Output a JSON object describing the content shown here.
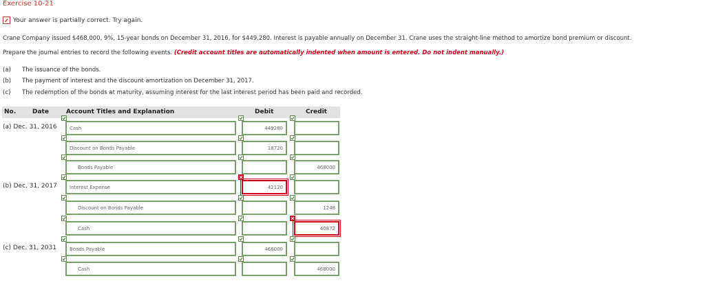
{
  "exercise_title": "Exercise 10-21",
  "banner": {
    "text": "Your answer is partially correct.  Try again."
  },
  "problem_text": "Crane Company issued $468,000, 9%, 15-year bonds on December 31, 2016, for $449,280. Interest is payable annually on December 31. Crane uses the straight-line method to amortize bond premium or discount.",
  "instructions": {
    "prefix": "Prepare the journal entries to record the following events. ",
    "emphasis": "(Credit account titles are automatically indented when amount is entered. Do not indent manually.)"
  },
  "requirements": [
    {
      "letter": "(a)",
      "text": "The issuance of the bonds."
    },
    {
      "letter": "(b)",
      "text": "The payment of interest and the discount amortization on December 31, 2017."
    },
    {
      "letter": "(c)",
      "text": "The redemption of the bonds at maturity, assuming interest for the last interest period has been paid and recorded."
    }
  ],
  "table_headers": {
    "no": "No.",
    "date": "Date",
    "account": "Account Titles and Explanation",
    "debit": "Debit",
    "credit": "Credit"
  },
  "entries": [
    {
      "label": "(a)  Dec. 31, 2016",
      "account": "Cash",
      "debit": "449280",
      "credit": "",
      "account_status": "correct",
      "debit_status": "correct",
      "credit_status": "correct"
    },
    {
      "label": "",
      "account": "Discount on Bonds Payable",
      "debit": "18720",
      "credit": "",
      "account_status": "correct",
      "debit_status": "correct",
      "credit_status": "correct"
    },
    {
      "label": "",
      "account": "Bonds Payable",
      "debit": "",
      "credit": "468000",
      "account_status": "correct",
      "debit_status": "correct",
      "credit_status": "correct"
    },
    {
      "label": "(b)  Dec. 31, 2017",
      "account": "Interest Expense",
      "debit": "42120",
      "credit": "",
      "account_status": "correct",
      "debit_status": "incorrect",
      "credit_status": "correct"
    },
    {
      "label": "",
      "account": "Discount on Bonds Payable",
      "debit": "",
      "credit": "1248",
      "account_status": "correct",
      "debit_status": "correct",
      "credit_status": "correct"
    },
    {
      "label": "",
      "account": "Cash",
      "debit": "",
      "credit": "40872",
      "account_status": "correct",
      "debit_status": "correct",
      "credit_status": "incorrect"
    },
    {
      "label": "(c)  Dec. 31, 2031",
      "account": "Bonds Payable",
      "debit": "468000",
      "credit": "",
      "account_status": "correct",
      "debit_status": "correct",
      "credit_status": "correct"
    },
    {
      "label": "",
      "account": "Cash",
      "debit": "",
      "credit": "468000",
      "account_status": "correct",
      "debit_status": "correct",
      "credit_status": "correct"
    }
  ],
  "colors": {
    "correct_border": "#7aa06a",
    "error_border": "#d0021b",
    "title": "#c0392b"
  },
  "icons": {
    "banner": "pencil-icon",
    "correct": "check-icon",
    "incorrect": "x-icon"
  }
}
